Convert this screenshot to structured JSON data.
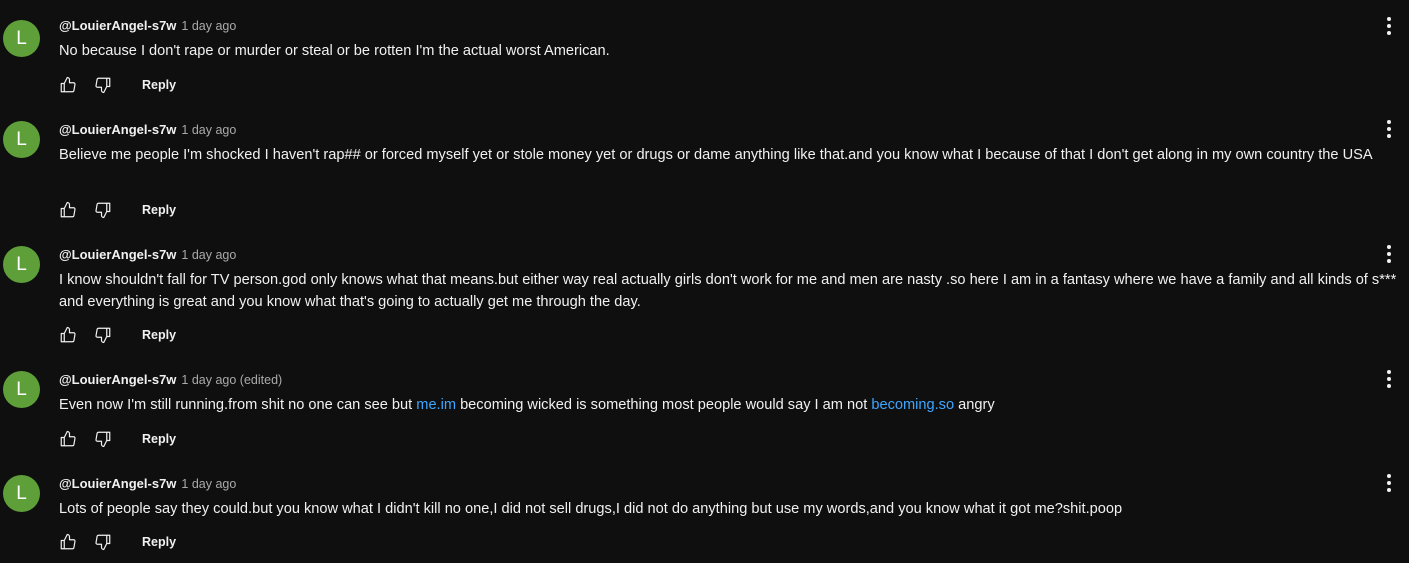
{
  "colors": {
    "background": "#0f0f0f",
    "avatar": "#5f9f3a",
    "link": "#3ea6ff"
  },
  "icons": {
    "like": "thumbs-up-icon",
    "dislike": "thumbs-down-icon",
    "menu": "more-vertical-icon"
  },
  "comments": [
    {
      "avatar_letter": "L",
      "author": "@LouierAngel-s7w",
      "time": "1 day ago",
      "text": "No because I don't rape or murder or steal or be rotten I'm the actual worst American.",
      "reply_label": "Reply"
    },
    {
      "avatar_letter": "L",
      "author": "@LouierAngel-s7w",
      "time": "1 day ago",
      "text": "Believe me people I'm shocked I haven't rap## or forced myself yet or stole money yet or drugs or dame anything like that.and you know what I because of that I don't get along in my own country the USA",
      "reply_label": "Reply"
    },
    {
      "avatar_letter": "L",
      "author": "@LouierAngel-s7w",
      "time": "1 day ago",
      "text": "I know shouldn't fall for TV person.god only knows what that means.but either way real actually girls don't work for me and men are nasty .so here I am in a fantasy where we have a family and all kinds of s*** and everything is great and you know what that's going to actually get me through the day.",
      "reply_label": "Reply"
    },
    {
      "avatar_letter": "L",
      "author": "@LouierAngel-s7w",
      "time": "1 day ago (edited)",
      "text_parts": [
        "Even now I'm still running.from shit no one can see but ",
        "me.im",
        " becoming wicked is something most people would say I am not ",
        "becoming.so",
        " angry"
      ],
      "reply_label": "Reply"
    },
    {
      "avatar_letter": "L",
      "author": "@LouierAngel-s7w",
      "time": "1 day ago",
      "text": "Lots of people say they could.but you know what I didn't kill no one,I did not sell drugs,I did not do anything but use my words,and you know what it got me?shit.poop",
      "reply_label": "Reply"
    }
  ]
}
